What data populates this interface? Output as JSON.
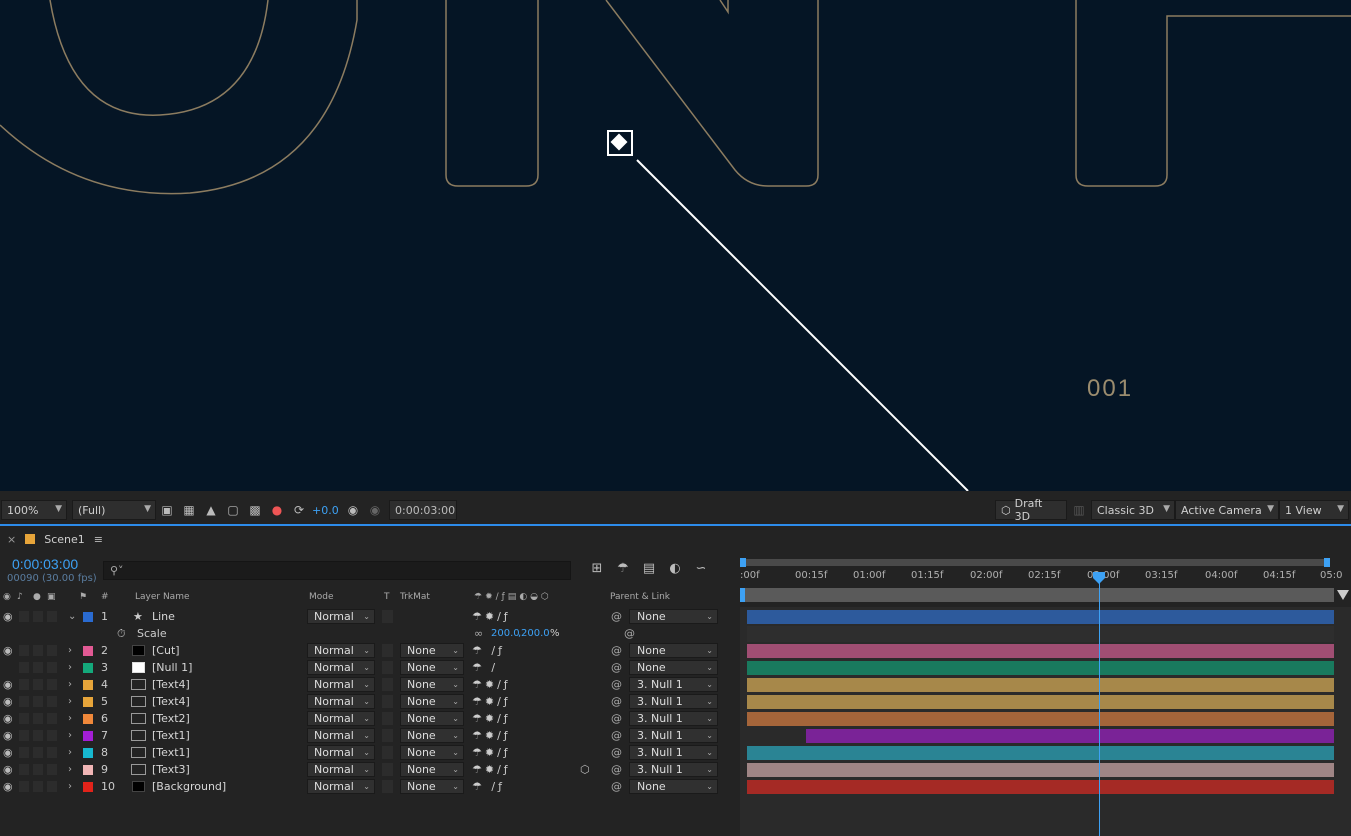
{
  "viewer": {
    "label": "001"
  },
  "viewer_bar": {
    "zoom": "100%",
    "resolution": "(Full)",
    "exposure": "+0.0",
    "timecode": "0:00:03:00",
    "renderer": "Draft 3D",
    "renderer_mode": "Classic 3D",
    "camera": "Active Camera",
    "views": "1 View"
  },
  "composition": {
    "name": "Scene1",
    "timecode": "0:00:03:00",
    "frames": "00090 (30.00 fps)"
  },
  "columns": {
    "hash": "#",
    "layer_name": "Layer Name",
    "mode": "Mode",
    "t": "T",
    "trkmat": "TrkMat",
    "parent": "Parent & Link"
  },
  "layers": [
    {
      "num": "1",
      "name": "Line",
      "mode": "Normal",
      "trkmat": "",
      "parent": "None",
      "color": "#2a6bd1",
      "eye": true,
      "type": "shape",
      "bar_color": "#2d5a9c",
      "bar_start": 0.0
    },
    {
      "num": "2",
      "name": "[Cut]",
      "mode": "Normal",
      "trkmat": "None",
      "parent": "None",
      "color": "#e25a94",
      "eye": true,
      "type": "solid-black",
      "bar_color": "#a04e73",
      "bar_start": 0.0
    },
    {
      "num": "3",
      "name": "[Null 1]",
      "mode": "Normal",
      "trkmat": "None",
      "parent": "None",
      "color": "#14a97b",
      "eye": false,
      "type": "solid-white",
      "bar_color": "#197a5e",
      "bar_start": 0.0
    },
    {
      "num": "4",
      "name": "[Text4]",
      "mode": "Normal",
      "trkmat": "None",
      "parent": "3. Null 1",
      "color": "#e7a53a",
      "eye": true,
      "type": "comp",
      "bar_color": "#a7884a",
      "bar_start": 0.0
    },
    {
      "num": "5",
      "name": "[Text4]",
      "mode": "Normal",
      "trkmat": "None",
      "parent": "3. Null 1",
      "color": "#e7a53a",
      "eye": true,
      "type": "comp",
      "bar_color": "#a7884a",
      "bar_start": 0.0
    },
    {
      "num": "6",
      "name": "[Text2]",
      "mode": "Normal",
      "trkmat": "None",
      "parent": "3. Null 1",
      "color": "#f0883a",
      "eye": true,
      "type": "comp",
      "bar_color": "#a5653a",
      "bar_start": 0.0
    },
    {
      "num": "7",
      "name": "[Text1]",
      "mode": "Normal",
      "trkmat": "None",
      "parent": "3. Null 1",
      "color": "#a41ed6",
      "eye": true,
      "type": "comp",
      "bar_color": "#7a2397",
      "bar_start": 0.1
    },
    {
      "num": "8",
      "name": "[Text1]",
      "mode": "Normal",
      "trkmat": "None",
      "parent": "3. Null 1",
      "color": "#17b8cf",
      "eye": true,
      "type": "comp",
      "bar_color": "#2a8494",
      "bar_start": 0.0
    },
    {
      "num": "9",
      "name": "[Text3]",
      "mode": "Normal",
      "trkmat": "None",
      "parent": "3. Null 1",
      "color": "#f0b5b5",
      "eye": true,
      "type": "comp",
      "bar_color": "#9f8585",
      "bar_start": 0.0
    },
    {
      "num": "10",
      "name": "[Background]",
      "mode": "Normal",
      "trkmat": "None",
      "parent": "None",
      "color": "#e2231a",
      "eye": true,
      "type": "solid-black",
      "bar_color": "#a52a25",
      "bar_start": 0.0
    }
  ],
  "property": {
    "name": "Scale",
    "value_x": "200.0",
    "value_y": "200.0",
    "unit": "%"
  },
  "ruler": {
    "ticks": [
      ":00f",
      "00:15f",
      "01:00f",
      "01:15f",
      "02:00f",
      "02:15f",
      "03:00f",
      "03:15f",
      "04:00f",
      "04:15f",
      "05:0"
    ]
  },
  "icons": {
    "close": "close-icon",
    "menu": "hamburger-menu-icon",
    "search": "search-icon"
  }
}
